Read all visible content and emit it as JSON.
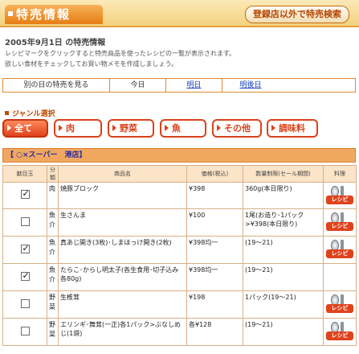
{
  "header": {
    "title": "特売情報",
    "search_button": "登録店以外で特売検索"
  },
  "date_heading": "2005年9月1日 の特売情報",
  "intro": [
    "レシピマークをクリックすると特売商品を使ったレシピの一覧が表示されます。",
    "欲しい食材をチェックしてお買い物メモを作成しましょう。"
  ],
  "day_bar": {
    "lead": "別の日の特売を見る",
    "today": "今日",
    "tomorrow": "明日",
    "day_after": "明後日"
  },
  "genre": {
    "title": "ジャンル選択",
    "buttons": [
      "全て",
      "肉",
      "野菜",
      "魚",
      "その他",
      "調味料"
    ],
    "active": "全て"
  },
  "store": {
    "header": "【 ○×スーパー　港店】"
  },
  "table": {
    "columns": [
      "献目玉",
      "分類",
      "商品名",
      "価格(税込)",
      "数量制限(セール期間)",
      "料理"
    ],
    "rows": [
      {
        "checked": true,
        "genre": "肉",
        "name": "焼豚ブロック",
        "price": "¥398",
        "qty": "360g(本日限り)",
        "recipe": true
      },
      {
        "checked": false,
        "genre": "魚介",
        "name": "生さんま",
        "price": "¥100",
        "qty": "1尾(お造り･1パック>¥398(本日限り)",
        "recipe": true
      },
      {
        "checked": true,
        "genre": "魚介",
        "name": "真あじ開き(3枚)･しまほっけ開き(2枚)",
        "price": "¥398均一",
        "qty": "(19〜21)",
        "recipe": true
      },
      {
        "checked": true,
        "genre": "魚介",
        "name": "たらこ･からし明太子(各生食用･切子込み各80g)",
        "price": "¥398均一",
        "qty": "(19〜21)",
        "recipe": false
      },
      {
        "checked": false,
        "genre": "野菜",
        "name": "生椎茸",
        "price": "¥198",
        "qty": "1パック(19〜21)",
        "recipe": true
      },
      {
        "checked": false,
        "genre": "野菜",
        "name": "エリンギ･舞茸(一正)各1パック>ぶなしめじ(1袋)",
        "price": "各¥128",
        "qty": "(19〜21)",
        "recipe": true
      }
    ],
    "recipe_label": "レシピ"
  }
}
